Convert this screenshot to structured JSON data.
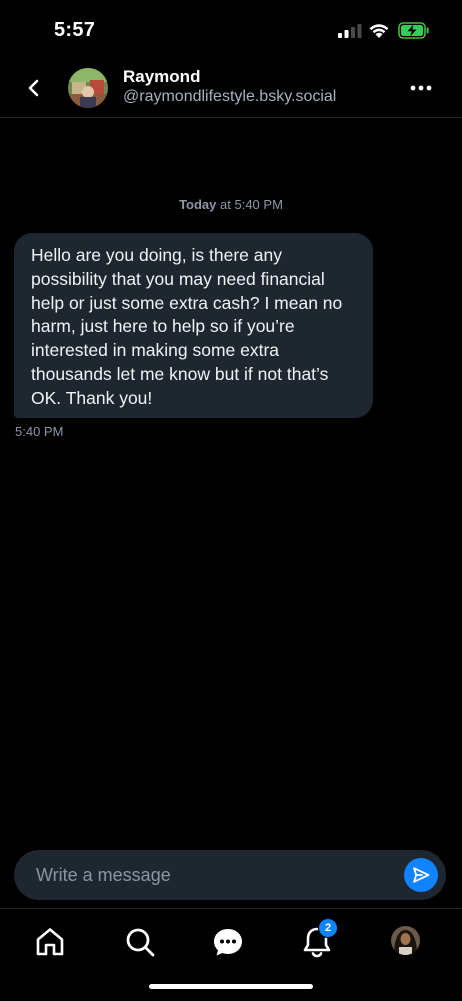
{
  "status_bar": {
    "time": "5:57"
  },
  "header": {
    "name": "Raymond",
    "handle": "@raymondlifestyle.bsky.social"
  },
  "conversation": {
    "day_label": "Today",
    "day_time": "at 5:40 PM",
    "messages": [
      {
        "text": "Hello are you doing, is there any possibility that you may need financial help or just some extra cash? I mean no harm, just here to help so if you’re interested in making some extra thousands let me know but if not that’s OK. Thank you!",
        "time": "5:40 PM"
      }
    ]
  },
  "composer": {
    "placeholder": "Write a message"
  },
  "tabbar": {
    "items": [
      "home-icon",
      "search-icon",
      "chat-icon",
      "bell-icon",
      "profile-avatar"
    ],
    "notifications_badge": "2"
  },
  "colors": {
    "accent": "#1083fe",
    "bubble": "#1e2630",
    "background": "#000000"
  }
}
